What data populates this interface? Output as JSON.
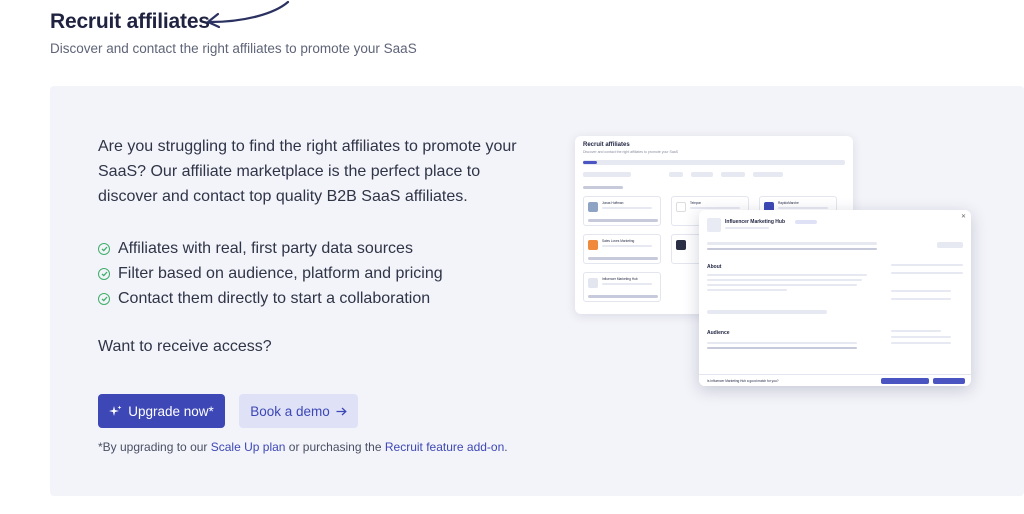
{
  "header": {
    "title": "Recruit affiliates",
    "subtitle": "Discover and contact the right affiliates to promote your SaaS"
  },
  "panel": {
    "lead": "Are you struggling to find the right affiliates to promote your SaaS? Our affiliate marketplace is the perfect place to discover and contact top quality B2B SaaS affiliates.",
    "features": [
      "Affiliates with real, first party data sources",
      "Filter based on audience, platform and pricing",
      "Contact them directly to start a collaboration"
    ],
    "access_question": "Want to receive access?",
    "upgrade_label": "Upgrade now*",
    "demo_label": "Book a demo",
    "footnote_pre": "*By upgrading to our ",
    "footnote_link1": "Scale Up plan",
    "footnote_mid": " or purchasing the ",
    "footnote_link2": "Recruit feature add-on",
    "footnote_end": "."
  },
  "preview": {
    "list_title": "Recruit affiliates",
    "list_subtitle": "Discover and contact the right affiliates to promote your SaaS",
    "cards": [
      "Jonas Hoffman",
      "Sales Loves Marketing",
      "Influencer Marketing Hub",
      "Telepon",
      "RapidoMarche"
    ],
    "detail_title": "Influencer Marketing Hub",
    "about_heading": "About",
    "audience_heading": "Audience",
    "footer_question": "Is Influencer Marketing Hub a good match for you?"
  },
  "colors": {
    "accent": "#3d47b5",
    "accent_soft": "#dfe2f7",
    "check": "#3fae6a",
    "panel_bg": "#f3f4f9"
  }
}
